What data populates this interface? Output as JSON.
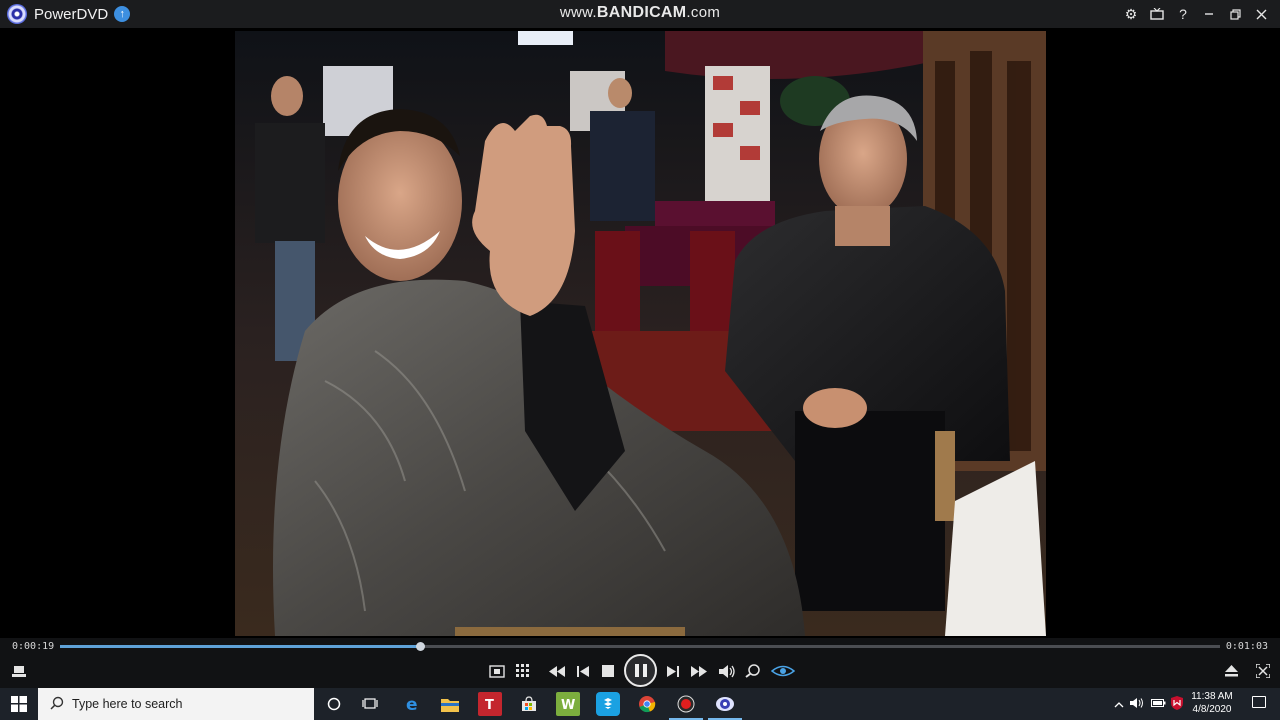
{
  "window": {
    "app_name": "PowerDVD",
    "watermark_prefix": "www.",
    "watermark_brand": "BANDICAM",
    "watermark_suffix": ".com"
  },
  "player": {
    "time_current": "0:00:19",
    "time_duration": "0:01:03",
    "progress_fraction": 0.31,
    "state": "playing"
  },
  "taskbar": {
    "search_placeholder": "Type here to search",
    "time": "11:38 AM",
    "date": "4/8/2020"
  },
  "colors": {
    "titlebar": "#1b1c1e",
    "controls": "#111214",
    "progress": "#5fa2d8",
    "taskbar": "#1d2229",
    "taskbar_accent": "#76b9ed"
  }
}
